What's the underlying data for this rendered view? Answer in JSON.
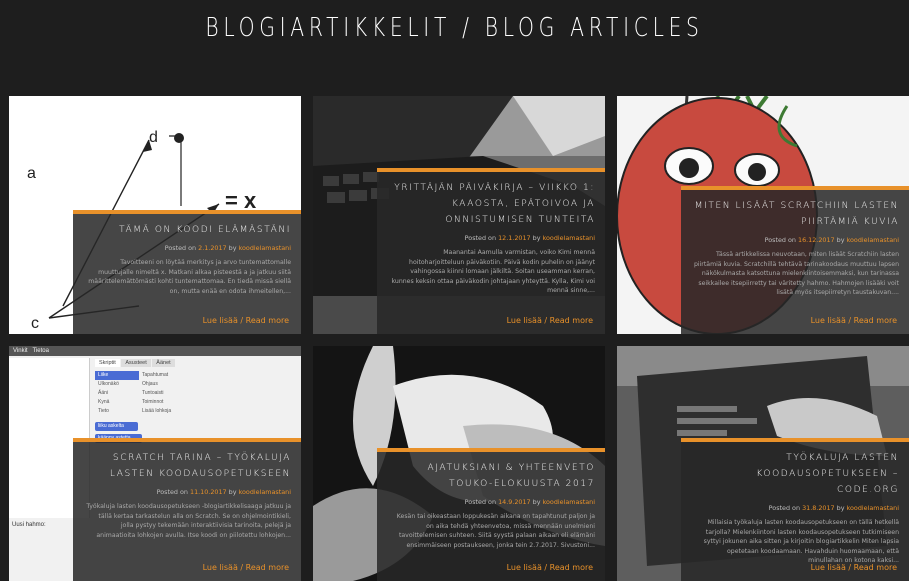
{
  "page": {
    "title": "BLOGIARTIKKELIT / BLOG ARTICLES"
  },
  "colors": {
    "accent": "#e8912a",
    "background": "#1e1e1e"
  },
  "posts": [
    {
      "title": "Tämä on koodi elämästäni",
      "posted_on": "Posted on",
      "date": "2.1.2017",
      "by": "by",
      "author": "koodielamastani",
      "excerpt": "Tavoitteeni on löytää merkitys ja arvo tuntemattomalle muuttujalle nimeltä x. Matkani alkaa pisteestä a ja jatkuu siitä määrittelemättömästi kohti tuntemattomaa. En tiedä missä siellä on, mutta enää en odota ihmeitellen,...",
      "read_more": "Lue lisää / Read more",
      "image": "diagram-abcd-x"
    },
    {
      "title": "Yrittäjän päiväkirja – Viikko 1: Kaaosta, epätoivoa ja onnistumisen tunteita",
      "posted_on": "Posted on",
      "date": "12.1.2017",
      "by": "by",
      "author": "koodielamastani",
      "excerpt": "Maanantai Aamulla varmistan, voiko Kimi mennä hoitoharjoitteluun päiväkotiin. Päivä kodin puhelin on jäänyt vahingossa kiinni lomaan jälkiltä. Soitan useamman kerran, kunnes keksin ottaa päiväkodin johtajaan yhteyttä. Kylla, Kimi voi mennä sinne,...",
      "read_more": "Lue lisää / Read more",
      "image": "laptop-keyboard-photo"
    },
    {
      "title": "Miten lisäät Scratchiin lasten piirtämiä kuvia",
      "posted_on": "Posted on",
      "date": "16.12.2017",
      "by": "by",
      "author": "koodielamastani",
      "excerpt": "Tässä artikkelissa neuvotaan, miten lisäät Scratchiin lasten piirtämiä kuvia. Scratchillä tehtävä tarinakoodaus muuttuu lapsen näkökulmasta katsottuna mielenkiintoisemmaksi, kun tarinassa seikkailee itsepiirretty tai väritetty hahmo. Hahmojen lisääki voit lisätä myös itsepiirretyn taustakuvan....",
      "read_more": "Lue lisää / Read more",
      "image": "drawn-tomato-character"
    },
    {
      "title": "Scratch tarina – työkaluja lasten koodausopetukseen",
      "posted_on": "Posted on",
      "date": "11.10.2017",
      "by": "by",
      "author": "koodielamastani",
      "excerpt": "Työkaluja lasten koodausopetukseen -blogiartikkelisaaga jatkuu ja tällä kertaa tarkastelun alla on Scratch. Se on ohjelmointikieli, jolla pystyy tekemään interaktiivisia tarinoita, pelejä ja animaatioita lohkojen avulla. Itse koodi on piilotettu lohkojen...",
      "read_more": "Lue lisää / Read more",
      "image": "scratch-editor-screenshot",
      "scratch_ui": {
        "menu": [
          "Vinkit",
          "Tietoa"
        ],
        "tabs": [
          "Skriptit",
          "Asusteet",
          "Äänet"
        ],
        "categories": [
          "Liike",
          "Ulkonäkö",
          "Ääni",
          "Kynä",
          "Tieto"
        ],
        "categories_right": [
          "Tapahtumat",
          "Ohjaus",
          "Tuntoaisti",
          "Toiminnot",
          "Lisää lohkoja"
        ],
        "new_sprite_label": "Uusi hahmo:",
        "block_labels": [
          "liiku",
          "askelta",
          "käänny",
          "astetta"
        ]
      }
    },
    {
      "title": "Ajatuksiani & yhteenveto touko-elokuusta 2017",
      "posted_on": "Posted on",
      "date": "14.9.2017",
      "by": "by",
      "author": "koodielamastani",
      "excerpt": "Kesän tai oikeastaan loppukesän aikana on tapahtunut paljon ja on aika tehdä yhteenvetoa, missä mennään unelmieni tavoittelemisen suhteen. Siitä syystä palaan aikaan eli elämäni ensimmäiseen postaukseen, jonka tein 2.7.2017. Sivustoni...",
      "read_more": "Lue lisää / Read more",
      "image": "flower-petals-photo"
    },
    {
      "title": "Työkaluja lasten koodausopetukseen – Code.org",
      "posted_on": "Posted on",
      "date": "31.8.2017",
      "by": "by",
      "author": "koodielamastani",
      "excerpt": "Millaisia työkaluja lasten koodausopetukseen on tällä hetkellä tarjolla? Mielenkiintoni lasten koodausopetukseen tutkimiseen syttyi jokunen aika sitten ja kirjoitin blogiartikkelin Miten lapsia opetetaan koodaamaan. Havahduin huomaamaan, että minullahan on kotona kaksi...",
      "read_more": "Lue lisää / Read more",
      "image": "tablet-hand-photo"
    }
  ]
}
